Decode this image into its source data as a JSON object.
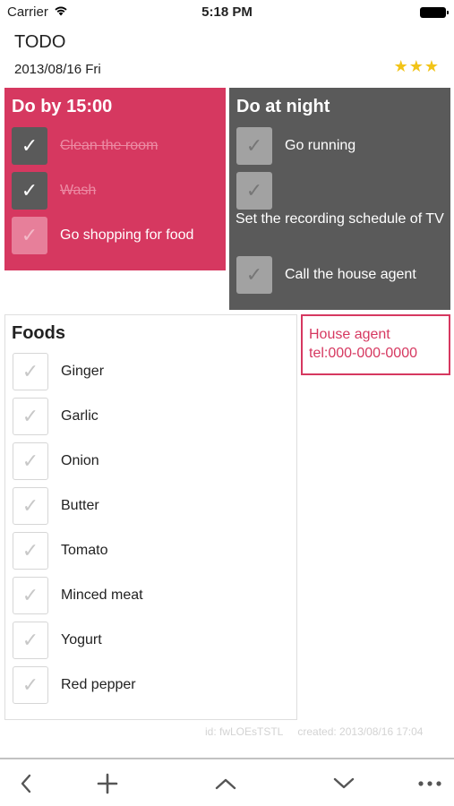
{
  "status_bar": {
    "carrier": "Carrier",
    "time": "5:18 PM"
  },
  "header": {
    "title": "TODO",
    "date": "2013/08/16 Fri",
    "stars": "★★★"
  },
  "card_pink": {
    "title": "Do by 15:00",
    "items": [
      {
        "label": "Clean the room",
        "checked": true
      },
      {
        "label": "Wash",
        "checked": true
      },
      {
        "label": "Go shopping for food",
        "checked": false
      }
    ]
  },
  "card_gray": {
    "title": "Do at night",
    "items": [
      {
        "label": "Go running",
        "checked": false
      },
      {
        "label": "Set the recording schedule of TV",
        "checked": false
      },
      {
        "label": "Call the house agent",
        "checked": false
      }
    ]
  },
  "foods": {
    "title": "Foods",
    "items": [
      "Ginger",
      "Garlic",
      "Onion",
      "Butter",
      "Tomato",
      "Minced meat",
      "Yogurt",
      "Red pepper"
    ]
  },
  "note": {
    "line1": "House agent",
    "line2": "tel:000-000-0000"
  },
  "meta": {
    "id": "id: fwLOEsTSTL",
    "created": "created: 2013/08/16 17:04"
  },
  "checkmark": "✓",
  "toolbar": {
    "icons": [
      "back-icon",
      "add-icon",
      "up-icon",
      "down-icon",
      "more-icon"
    ]
  },
  "colors": {
    "accent_pink": "#d63860",
    "card_gray": "#5a5a5a",
    "star": "#f2c418"
  }
}
